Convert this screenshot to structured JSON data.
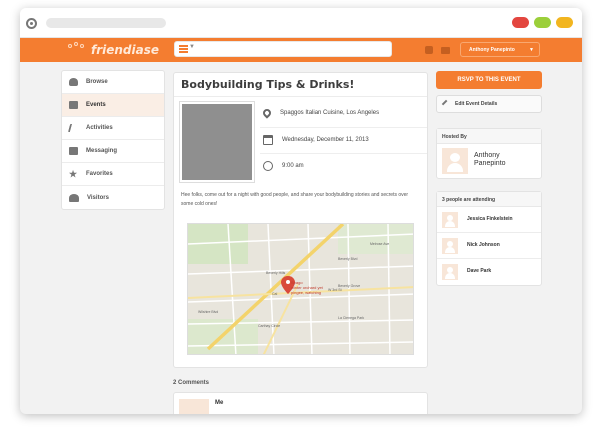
{
  "browser": {
    "url": ""
  },
  "app": {
    "logo_text": "friendiase"
  },
  "navbar": {
    "search_value": "",
    "user_button": "Anthony Panepinto"
  },
  "sidebar": {
    "items": [
      {
        "label": "Browse",
        "icon": "person-icon",
        "active": false
      },
      {
        "label": "Events",
        "icon": "calendar-icon",
        "active": true
      },
      {
        "label": "Activities",
        "icon": "runner-icon",
        "active": false
      },
      {
        "label": "Messaging",
        "icon": "message-icon",
        "active": false
      },
      {
        "label": "Favorites",
        "icon": "star-icon",
        "active": false
      },
      {
        "label": "Visitors",
        "icon": "people-icon",
        "active": false
      }
    ]
  },
  "event": {
    "title": "Bodybuilding Tips & Drinks!",
    "location": "Spaggos Italian Cuisine, Los Angeles",
    "date": "Wednesday, December 11, 2013",
    "time": "9:00 am",
    "description": "Hee folks, come out for a night with good people, and share your bodybuilding stories and secrets over some cold ones!",
    "map": {
      "pin_label_line1": "Spago",
      "pin_label_line2": "winter orchard yet",
      "pin_label_line3": "pingee, watching",
      "street_labels": [
        "Beverly Hills",
        "Beverly Blvd",
        "Melrose Ave",
        "W 3rd St",
        "Wilshire Blvd",
        "La Cienega Park",
        "Beverly Grove",
        "Carthay Circle",
        "Cal"
      ]
    }
  },
  "comments": {
    "count_label": "2 Comments",
    "items": [
      {
        "author": "Me"
      }
    ]
  },
  "actions": {
    "rsvp": "RSVP TO THIS EVENT",
    "edit": "Edit Event Details"
  },
  "host": {
    "header": "Hosted By",
    "name": "Anthony Panepinto"
  },
  "attendees": {
    "header": "3 people are attending",
    "list": [
      "Jessica Finkelstein",
      "Nick Johnson",
      "Dave Park"
    ]
  },
  "colors": {
    "brand": "#f47d30",
    "active_bg": "#faeee5"
  }
}
